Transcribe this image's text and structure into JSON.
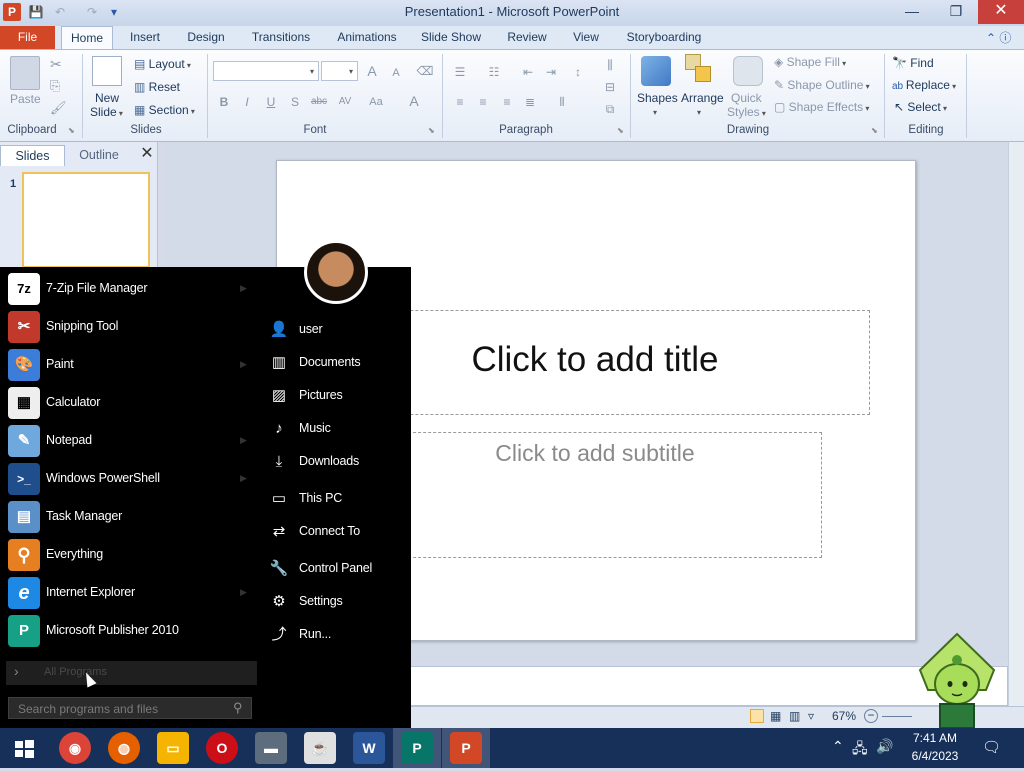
{
  "window": {
    "title": "Presentation1 - Microsoft PowerPoint",
    "app_logo": "P",
    "controls": {
      "minimize": "—",
      "maximize": "❐",
      "close": "✕"
    }
  },
  "quick_access": {
    "save": "💾",
    "undo": "↶",
    "redo": "↷",
    "customize": "▾"
  },
  "ribbon_tabs": [
    "File",
    "Home",
    "Insert",
    "Design",
    "Transitions",
    "Animations",
    "Slide Show",
    "Review",
    "View",
    "Storyboarding"
  ],
  "active_tab": "Home",
  "ribbon": {
    "clipboard": {
      "paste": "Paste",
      "label": "Clipboard"
    },
    "slides": {
      "new_slide": "New",
      "new_slide_2": "Slide",
      "layout": "Layout",
      "reset": "Reset",
      "section": "Section",
      "label": "Slides"
    },
    "font": {
      "label": "Font",
      "bold": "B",
      "italic": "I",
      "underline": "U",
      "shadow": "S",
      "strike": "abc",
      "spacing": "AV",
      "case": "Aa",
      "color": "A",
      "grow": "A",
      "shrink": "A"
    },
    "paragraph": {
      "label": "Paragraph"
    },
    "drawing": {
      "shapes": "Shapes",
      "arrange": "Arrange",
      "quick_styles": "Quick",
      "quick_styles_2": "Styles",
      "shape_fill": "Shape Fill",
      "shape_outline": "Shape Outline",
      "shape_effects": "Shape Effects",
      "label": "Drawing"
    },
    "editing": {
      "find": "Find",
      "replace": "Replace",
      "select": "Select",
      "label": "Editing"
    }
  },
  "left_pane": {
    "tab_slides": "Slides",
    "tab_outline": "Outline",
    "close": "✕",
    "slide_number": "1"
  },
  "slide": {
    "title_placeholder": "Click to add title",
    "subtitle_placeholder": "Click to add subtitle"
  },
  "status_bar": {
    "zoom": "67%",
    "zoom_out": "−",
    "zoom_in": "+"
  },
  "start_menu": {
    "programs": [
      {
        "label": "7-Zip File Manager",
        "icon": "7z",
        "color": "#ffffff",
        "text_color": "#000000"
      },
      {
        "label": "Snipping Tool",
        "icon": "✂",
        "color": "#c0392b",
        "text_color": "#ffffff"
      },
      {
        "label": "Paint",
        "icon": "🎨",
        "color": "#3b7dd8",
        "text_color": "#ffffff"
      },
      {
        "label": "Calculator",
        "icon": "▦",
        "color": "#eeeeee",
        "text_color": "#000000"
      },
      {
        "label": "Notepad",
        "icon": "✎",
        "color": "#6fa8dc",
        "text_color": "#ffffff"
      },
      {
        "label": "Windows PowerShell",
        "icon": ">_",
        "color": "#1f4e8c",
        "text_color": "#ffffff"
      },
      {
        "label": "Task Manager",
        "icon": "▤",
        "color": "#5a8fc7",
        "text_color": "#ffffff"
      },
      {
        "label": "Everything",
        "icon": "⚲",
        "color": "#e67e22",
        "text_color": "#ffffff"
      },
      {
        "label": "Internet Explorer",
        "icon": "e",
        "color": "#1e88e5",
        "text_color": "#ffffff"
      },
      {
        "label": "Microsoft Publisher 2010",
        "icon": "P",
        "color": "#16a085",
        "text_color": "#ffffff"
      }
    ],
    "places": [
      {
        "label": "user",
        "icon": "👤"
      },
      {
        "label": "Documents",
        "icon": "▥"
      },
      {
        "label": "Pictures",
        "icon": "▨"
      },
      {
        "label": "Music",
        "icon": "♪"
      },
      {
        "label": "Downloads",
        "icon": "⤓"
      },
      {
        "label": "This PC",
        "icon": "▭"
      },
      {
        "label": "Connect To",
        "icon": "⇄"
      },
      {
        "label": "Control Panel",
        "icon": "🔧"
      },
      {
        "label": "Settings",
        "icon": "⚙"
      },
      {
        "label": "Run...",
        "icon": "⤴"
      }
    ],
    "all_programs": "All Programs",
    "search_placeholder": "Search programs and files"
  },
  "taskbar": {
    "apps": [
      {
        "name": "chrome",
        "glyph": "◉",
        "color": "#db4437"
      },
      {
        "name": "firefox",
        "glyph": "◍",
        "color": "#e66000"
      },
      {
        "name": "file-explorer",
        "glyph": "▭",
        "color": "#f4b400"
      },
      {
        "name": "opera",
        "glyph": "O",
        "color": "#cc0f16"
      },
      {
        "name": "network",
        "glyph": "▬",
        "color": "#5d6d7e"
      },
      {
        "name": "java",
        "glyph": "☕",
        "color": "#e0e0e0"
      },
      {
        "name": "word",
        "glyph": "W",
        "color": "#2b579a"
      },
      {
        "name": "publisher",
        "glyph": "P",
        "color": "#077568"
      },
      {
        "name": "powerpoint",
        "glyph": "P",
        "color": "#d24726"
      }
    ],
    "time": "7:41 AM",
    "date": "6/4/2023"
  }
}
